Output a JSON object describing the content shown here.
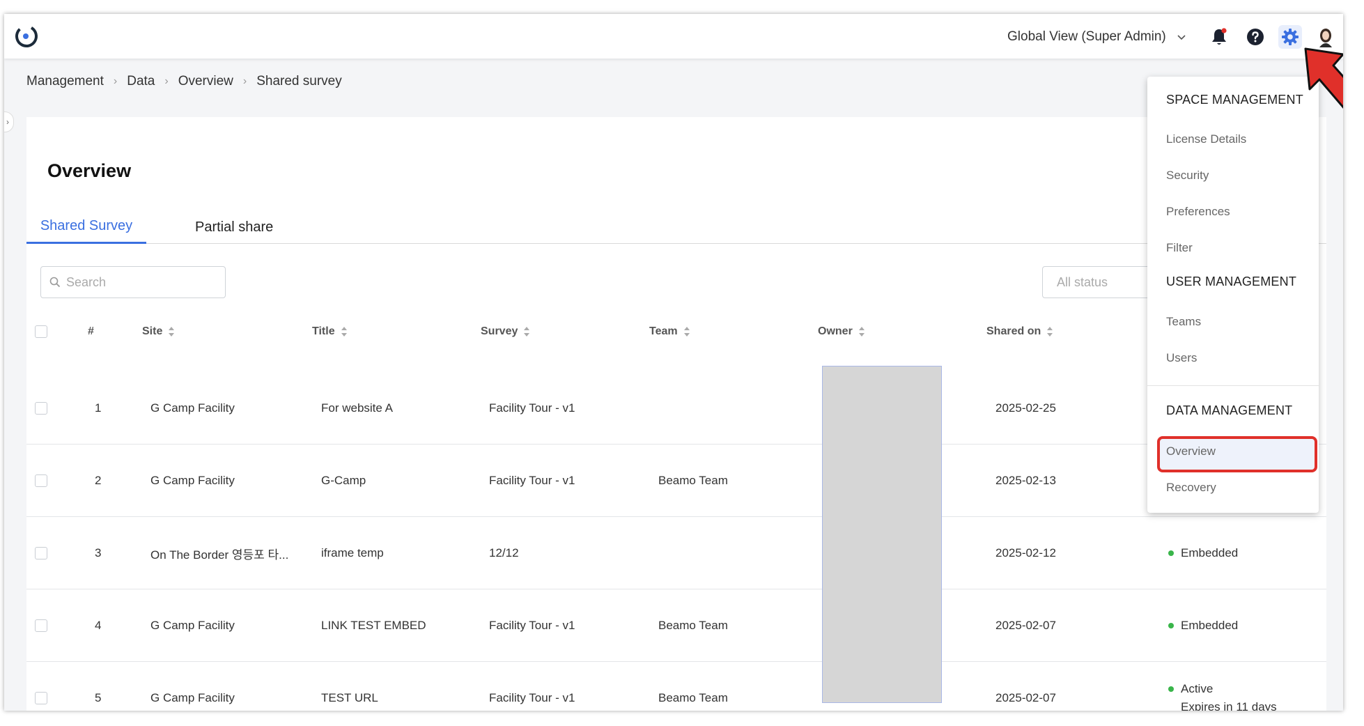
{
  "topbar": {
    "space_selector": "Global View (Super Admin)",
    "icons": [
      "bell-icon",
      "help-icon",
      "gear-icon",
      "avatar"
    ]
  },
  "breadcrumb": [
    "Management",
    "Data",
    "Overview",
    "Shared survey"
  ],
  "page": {
    "title": "Overview",
    "tabs": [
      {
        "label": "Shared Survey",
        "active": true
      },
      {
        "label": "Partial share",
        "active": false
      }
    ],
    "search_placeholder": "Search",
    "status_filter_placeholder": "All status"
  },
  "table": {
    "headers": {
      "index": "#",
      "site": "Site",
      "title": "Title",
      "survey": "Survey",
      "team": "Team",
      "owner": "Owner",
      "shared_on": "Shared on"
    },
    "rows": [
      {
        "index": "1",
        "site": "G Camp Facility",
        "title": "For website A",
        "survey": "Facility Tour - v1",
        "team": "",
        "shared_on": "2025-02-25",
        "status": "",
        "status_sub": ""
      },
      {
        "index": "2",
        "site": "G Camp Facility",
        "title": "G-Camp",
        "survey": "Facility Tour - v1",
        "team": "Beamo Team",
        "shared_on": "2025-02-13",
        "status": "",
        "status_sub": ""
      },
      {
        "index": "3",
        "site": "On The Border 영등포 타...",
        "title": "iframe temp",
        "survey": "12/12",
        "team": "",
        "shared_on": "2025-02-12",
        "status": "Embedded",
        "status_sub": ""
      },
      {
        "index": "4",
        "site": "G Camp Facility",
        "title": "LINK TEST EMBED",
        "survey": "Facility Tour - v1",
        "team": "Beamo Team",
        "shared_on": "2025-02-07",
        "status": "Embedded",
        "status_sub": ""
      },
      {
        "index": "5",
        "site": "G Camp Facility",
        "title": "TEST URL",
        "survey": "Facility Tour - v1",
        "team": "Beamo Team",
        "shared_on": "2025-02-07",
        "status": "Active",
        "status_sub": "Expires in 11 days"
      }
    ]
  },
  "settings_menu": {
    "space_management": {
      "heading": "SPACE MANAGEMENT",
      "items": [
        "License Details",
        "Security",
        "Preferences",
        "Filter"
      ]
    },
    "user_management": {
      "heading": "USER MANAGEMENT",
      "items": [
        "Teams",
        "Users"
      ]
    },
    "data_management": {
      "heading": "DATA MANAGEMENT",
      "items": [
        "Overview",
        "Recovery"
      ]
    },
    "highlighted_item": "Overview"
  },
  "colors": {
    "accent": "#3a6fe0",
    "status_green": "#39b54a",
    "annotation_red": "#e0302a"
  }
}
